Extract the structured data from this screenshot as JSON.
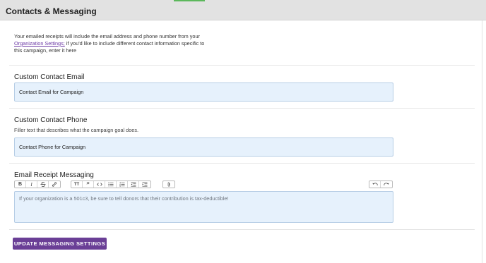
{
  "header": {
    "title": "Contacts & Messaging"
  },
  "intro": {
    "text_before_link": "Your emailed receipts will include the email address and phone number from your",
    "link_text": "Organization Settings;",
    "text_after_link": "if you'd like to include different contact information specific to this campaign, enter it here"
  },
  "contact_email": {
    "title": "Custom Contact Email",
    "value": "Contact Email for Campaign"
  },
  "contact_phone": {
    "title": "Custom Contact Phone",
    "helper": "Filler text that describes what the campaign goal does.",
    "value": "Contact Phone for Campaign"
  },
  "receipt": {
    "title": "Email Receipt Messaging",
    "placeholder": "If your organization is a 501c3, be sure to tell donors that their contribution is tax-deductible!",
    "toolbar": {
      "bold": "B",
      "italic": "I",
      "heading": "TT",
      "quote": "”"
    }
  },
  "actions": {
    "submit_label": "UPDATE MESSAGING SETTINGS"
  },
  "colors": {
    "accent": "#6a3f96",
    "field_bg": "#e6f1fc",
    "link": "#6d3ba6",
    "tab_indicator": "#5cb85c"
  }
}
